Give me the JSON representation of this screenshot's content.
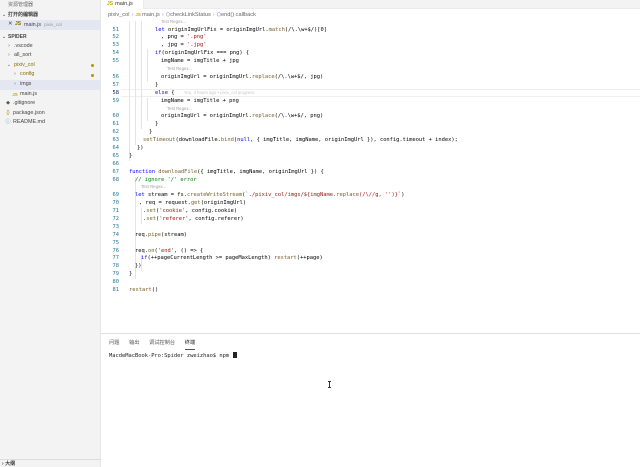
{
  "sidebar": {
    "title": "资源管理器",
    "open_editors": {
      "label": "打开的编辑器",
      "items": [
        {
          "close": "✕",
          "name": "main.js",
          "hint": "pixiv_col"
        }
      ]
    },
    "project": {
      "label": "SPIDER",
      "items": [
        {
          "chevron": "›",
          "name": ".vscode"
        },
        {
          "chevron": "›",
          "name": "all_sort"
        },
        {
          "chevron": "⌄",
          "name": "pixiv_col",
          "modified": true
        },
        {
          "chevron": "›",
          "name": "config",
          "modified": true
        },
        {
          "chevron": "›",
          "name": "imgs"
        },
        {
          "chevron": "",
          "name": "main.js"
        },
        {
          "chevron": "",
          "name": ".gitignore"
        },
        {
          "chevron": "",
          "name": "package.json"
        },
        {
          "chevron": "",
          "name": "README.md"
        }
      ]
    },
    "outline_label": "大纲"
  },
  "editor": {
    "tab": {
      "label": "main.js"
    },
    "breadcrumb": [
      "pixiv_col",
      "main.js",
      "checkLinkStatus",
      "end() callback"
    ],
    "lines": [
      {
        "ln": "51",
        "text": "let originImgUrlFix = originImgUrl.match(/\\.\\w+$/)[0]"
      },
      {
        "ln": "52",
        "text": ", png = '.png'"
      },
      {
        "ln": "53",
        "text": ", jpg = '.jpg'"
      },
      {
        "ln": "54",
        "text": "if(originImgUrlFix === png) {"
      },
      {
        "ln": "55",
        "text": "imgName = imgTitle + jpg"
      },
      {
        "ln": "56",
        "text": "originImgUrl = originImgUrl.replace(/\\.\\w+$/, jpg)"
      },
      {
        "ln": "57",
        "text": "}"
      },
      {
        "ln": "58",
        "text": "else {"
      },
      {
        "ln": "59",
        "text": "imgName = imgTitle + png"
      },
      {
        "ln": "60",
        "text": "originImgUrl = originImgUrl.replace(/\\.\\w+$/, png)"
      },
      {
        "ln": "61",
        "text": "}"
      },
      {
        "ln": "62",
        "text": "}"
      },
      {
        "ln": "63",
        "text": "setTimeout(downloadFile.bind(null, { imgTitle, imgName, originImgUrl }), config.timeout + index);"
      },
      {
        "ln": "64",
        "text": "})"
      },
      {
        "ln": "65",
        "text": "}"
      },
      {
        "ln": "66",
        "text": ""
      },
      {
        "ln": "67",
        "text": "function downloadFile({ imgTitle, imgName, originImgUrl }) {"
      },
      {
        "ln": "68",
        "text": "// ignore '/' error"
      },
      {
        "ln": "69",
        "text": "let stream = fs.createWriteStream(`./pixiv_col/imgs/${imgName.replace(/\\//g, '')}`)"
      },
      {
        "ln": "70",
        "text": ", req = request.get(originImgUrl)"
      },
      {
        "ln": "71",
        "text": ".set('cookie', config.cookie)"
      },
      {
        "ln": "72",
        "text": ".set('referer', config.referer)"
      },
      {
        "ln": "73",
        "text": ""
      },
      {
        "ln": "74",
        "text": "req.pipe(stream)"
      },
      {
        "ln": "75",
        "text": ""
      },
      {
        "ln": "76",
        "text": "req.on('end', () => {"
      },
      {
        "ln": "77",
        "text": "if(++pageCurrentLength >= pageMaxLength) restart(++page)"
      },
      {
        "ln": "78",
        "text": "})"
      },
      {
        "ln": "79",
        "text": "}"
      },
      {
        "ln": "80",
        "text": ""
      },
      {
        "ln": "81",
        "text": "restart()"
      }
    ],
    "codelens": "Test Regex...",
    "blame_hint": "You, 4 hours ago • pixiv_col progress"
  },
  "panel": {
    "tabs": [
      "问题",
      "输出",
      "调试控制台",
      "终端"
    ],
    "active_tab": 3,
    "terminal_line": "MacdeMacBook-Pro:Spider zweizhao$ npm "
  },
  "colors": {
    "line_number": "#237893",
    "keyword": "#0000ff",
    "string": "#a31515",
    "comment": "#008000",
    "modified_dot": "#b89500"
  }
}
